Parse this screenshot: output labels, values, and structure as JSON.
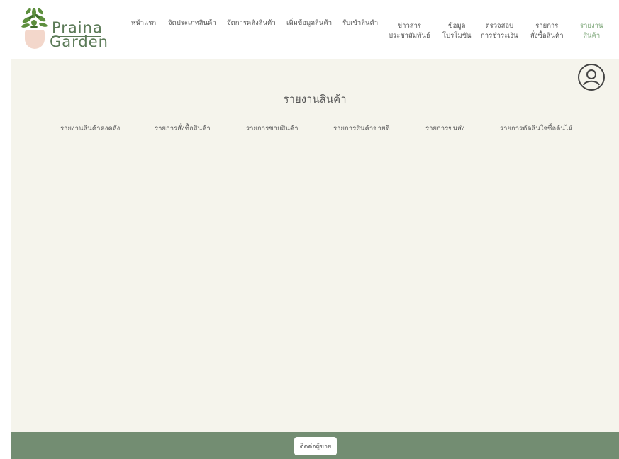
{
  "logo": {
    "line1": "Praina",
    "line2": "Garden"
  },
  "nav": [
    {
      "label": "หน้าแรก"
    },
    {
      "label": "จัดประเภทสินค้า"
    },
    {
      "label": "จัดการคลังสินค้า"
    },
    {
      "label": "เพิ่มข้อมูลสินค้า"
    },
    {
      "label": "รับเข้าสินค้า"
    },
    {
      "line1": "ข่าวสาร",
      "line2": "ประชาสัมพันธ์"
    },
    {
      "line1": "ข้อมูล",
      "line2": "โปรโมชัน"
    },
    {
      "line1": "ตรวจสอบ",
      "line2": "การชำระเงิน"
    },
    {
      "line1": "รายการ",
      "line2": "สั่งซื้อสินค้า"
    },
    {
      "line1": "รายงาน",
      "line2": "สินค้า",
      "active": true
    }
  ],
  "page_title": "รายงานสินค้า",
  "tabs": [
    {
      "label": "รายงานสินค้าคงคลัง"
    },
    {
      "label": "รายการสั่งซื้อสินค้า"
    },
    {
      "label": "รายการขายสินค้า"
    },
    {
      "label": "รายการสินค้าขายดี"
    },
    {
      "label": "รายการขนส่ง"
    },
    {
      "label": "รายการตัดสินใจซื้อต้นไม้"
    }
  ],
  "footer": {
    "contact_label": "ติดต่อผู้ขาย"
  },
  "colors": {
    "accent": "#7fa87b",
    "footer": "#738d72",
    "panel": "#f5f4ec",
    "pot": "#f3d7cb"
  }
}
